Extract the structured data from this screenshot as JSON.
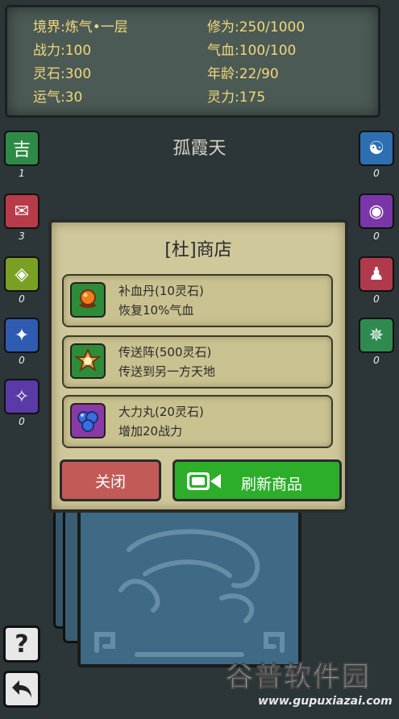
{
  "stats": {
    "realm": {
      "label": "境界:",
      "value": "炼气•一层"
    },
    "cultivation": {
      "label": "修为:",
      "value": "250/1000"
    },
    "power": {
      "label": "战力:",
      "value": "100"
    },
    "hp": {
      "label": "气血:",
      "value": "100/100"
    },
    "stones": {
      "label": "灵石:",
      "value": "300"
    },
    "age": {
      "label": "年龄:",
      "value": "22/90"
    },
    "luck": {
      "label": "运气:",
      "value": "30"
    },
    "spirit": {
      "label": "灵力:",
      "value": "175"
    }
  },
  "location": "孤霞天",
  "left_icons": [
    {
      "name": "fortune",
      "glyph": "吉",
      "count": "1",
      "color": "#2e8b47"
    },
    {
      "name": "scroll",
      "glyph": "✉",
      "count": "3",
      "color": "#b83b4a"
    },
    {
      "name": "bag",
      "glyph": "◈",
      "count": "0",
      "color": "#7aa023"
    },
    {
      "name": "beast-blue",
      "glyph": "✦",
      "count": "0",
      "color": "#2f5bb2"
    },
    {
      "name": "beast-purple",
      "glyph": "✧",
      "count": "0",
      "color": "#5a3aa6"
    }
  ],
  "right_icons": [
    {
      "name": "taiji",
      "glyph": "☯",
      "count": "0",
      "color": "#2d6fb0"
    },
    {
      "name": "orb",
      "glyph": "◉",
      "count": "0",
      "color": "#7a36a8"
    },
    {
      "name": "cloak",
      "glyph": "♟",
      "count": "0",
      "color": "#b03a4c"
    },
    {
      "name": "array",
      "glyph": "✵",
      "count": "0",
      "color": "#2f8a50"
    }
  ],
  "shop": {
    "title": "[杜]商店",
    "items": [
      {
        "name": "补血丹(10灵石)",
        "desc": "恢复10%气血",
        "icon": "pill-icon",
        "color": "#2e8b3a"
      },
      {
        "name": "传送阵(500灵石)",
        "desc": "传送到另一方天地",
        "icon": "teleport-icon",
        "color": "#2e8b3a"
      },
      {
        "name": "大力丸(20灵石)",
        "desc": "增加20战力",
        "icon": "strength-icon",
        "color": "#8a3aa6"
      }
    ],
    "close_label": "关闭",
    "refresh_label": "刷新商品"
  },
  "help_glyph": "?",
  "back_glyph": "↶",
  "watermark": {
    "title": "谷普软件园",
    "url": "www.gupuxiazai.com"
  }
}
